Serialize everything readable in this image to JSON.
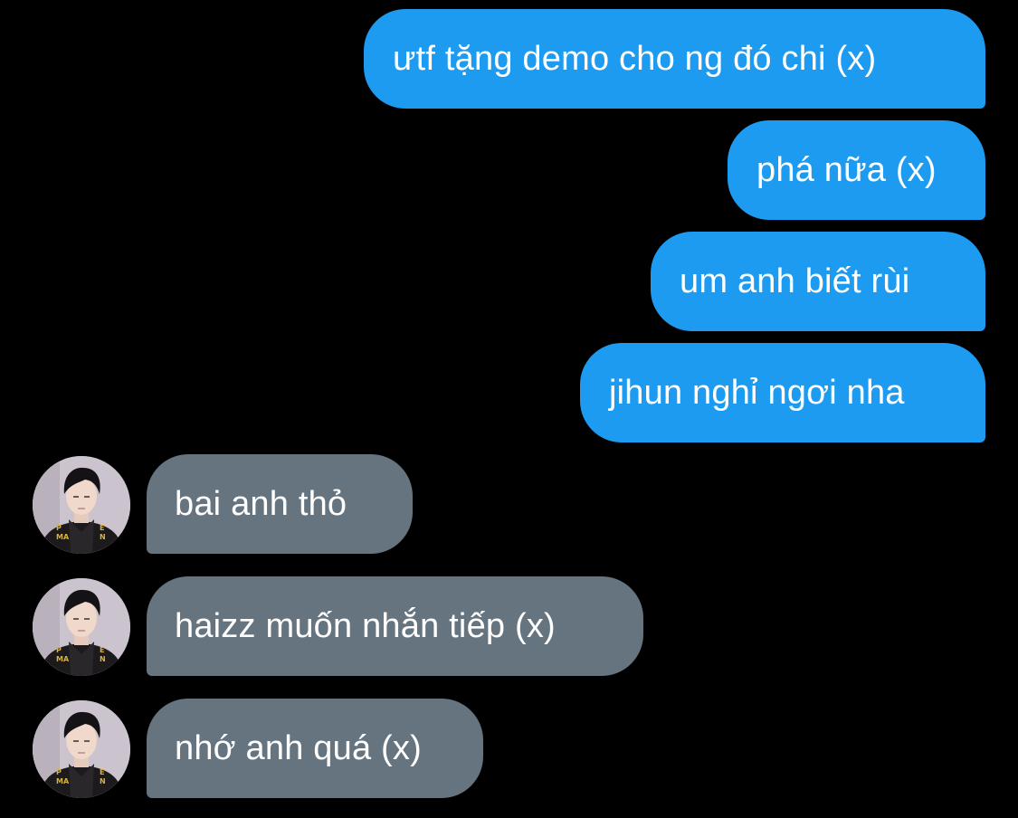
{
  "conversation": {
    "sent": [
      {
        "text": "ưtf tặng demo cho ng đó chi (x)"
      },
      {
        "text": "phá nữa (x)"
      },
      {
        "text": "um anh biết rùi"
      },
      {
        "text": "jihun nghỉ ngơi nha"
      }
    ],
    "received": [
      {
        "text": "bai anh thỏ",
        "avatar": "profile-photo"
      },
      {
        "text": "haizz muốn nhắn tiếp (x)",
        "avatar": "profile-photo"
      },
      {
        "text": "nhớ anh quá (x)",
        "avatar": "profile-photo"
      }
    ]
  },
  "colors": {
    "background": "#000000",
    "sent_bubble": "#1d9bf0",
    "received_bubble": "#66747f",
    "text": "#ffffff"
  }
}
